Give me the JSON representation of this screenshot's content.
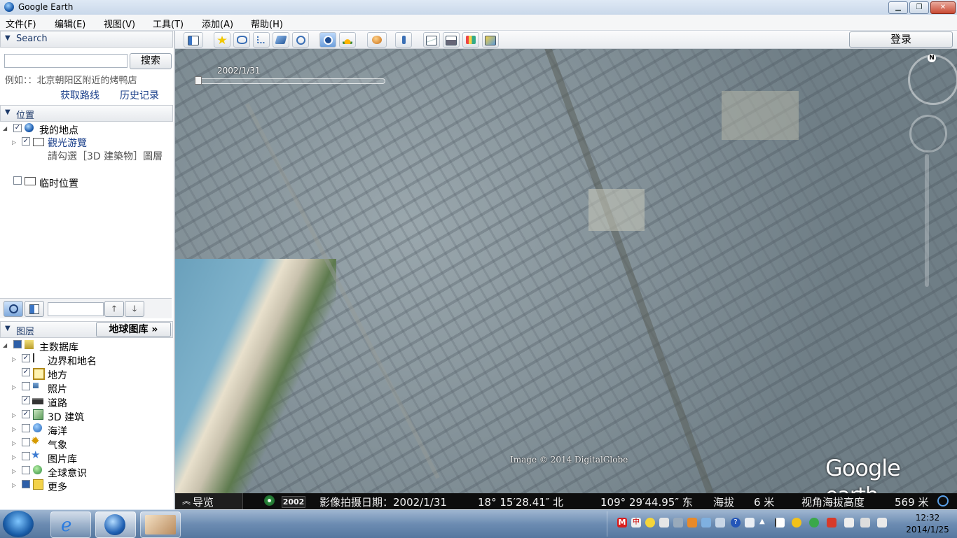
{
  "window": {
    "title": "Google Earth"
  },
  "menu": [
    "文件(F)",
    "编辑(E)",
    "视图(V)",
    "工具(T)",
    "添加(A)",
    "帮助(H)"
  ],
  "search": {
    "header": "Search",
    "input_value": "",
    "button": "搜索",
    "example": "例如：：北京朝阳区附近的烤鸭店",
    "get_directions": "获取路线",
    "history": "历史记录"
  },
  "places": {
    "header": "位置",
    "my_places": "我的地点",
    "tour_folder": "觀光游覽",
    "tour_hint": "請勾選［3D 建築物］圖層",
    "temp_places": "临时位置"
  },
  "layers": {
    "header": "图层",
    "gallery_button": "地球图库 »",
    "items": [
      {
        "label": "主数据库",
        "checked": "partial"
      },
      {
        "label": "边界和地名",
        "checked": true
      },
      {
        "label": "地方",
        "checked": true
      },
      {
        "label": "照片",
        "checked": false
      },
      {
        "label": "道路",
        "checked": true
      },
      {
        "label": "3D 建筑",
        "checked": true
      },
      {
        "label": "海洋",
        "checked": false
      },
      {
        "label": "气象",
        "checked": false
      },
      {
        "label": "图片库",
        "checked": false
      },
      {
        "label": "全球意识",
        "checked": false
      },
      {
        "label": "更多",
        "checked": "partial"
      }
    ]
  },
  "toolbar": {
    "sign_in": "登录"
  },
  "map": {
    "time_slider_date": "2002/1/31",
    "compass_n": "N",
    "credit": "Image © 2014 DigitalGlobe",
    "logo_google": "Google",
    "logo_earth": " earth"
  },
  "status": {
    "navigation": "导览",
    "year_badge": "2002",
    "imagery_date": "影像拍摄日期：2002/1/31",
    "lat": "18° 15′28.41″ 北",
    "lon": "109° 29′44.95″ 东",
    "elevation_label": "海拔",
    "elevation": "6 米",
    "eye_alt_label": "视角海拔高度",
    "eye_alt": "569 米"
  },
  "taskbar": {
    "time": "12:32",
    "date": "2014/1/25"
  },
  "colors": {
    "accent": "#1f3b6a",
    "link": "#1a3f8a",
    "status_bg": "#0d0d0d"
  }
}
